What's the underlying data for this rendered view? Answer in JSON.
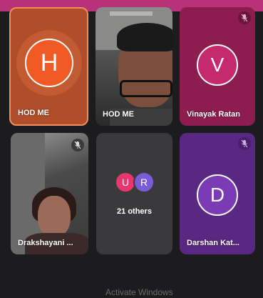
{
  "participants": [
    {
      "name": "HOD ME",
      "initial": "H"
    },
    {
      "name": "HOD ME"
    },
    {
      "name": "Vinayak Ratan",
      "initial": "V"
    },
    {
      "name": "Drakshayani ..."
    },
    {
      "name": "21 others",
      "initials": [
        "U",
        "R"
      ]
    },
    {
      "name": "Darshan Kat...",
      "initial": "D"
    }
  ],
  "watermark": "Activate Windows",
  "icons": {
    "mute": "mic-off-icon"
  },
  "colors": {
    "top_bar": "#b8327a",
    "background": "#1c1c1e",
    "active_speaker_border": "#f08e5c"
  }
}
